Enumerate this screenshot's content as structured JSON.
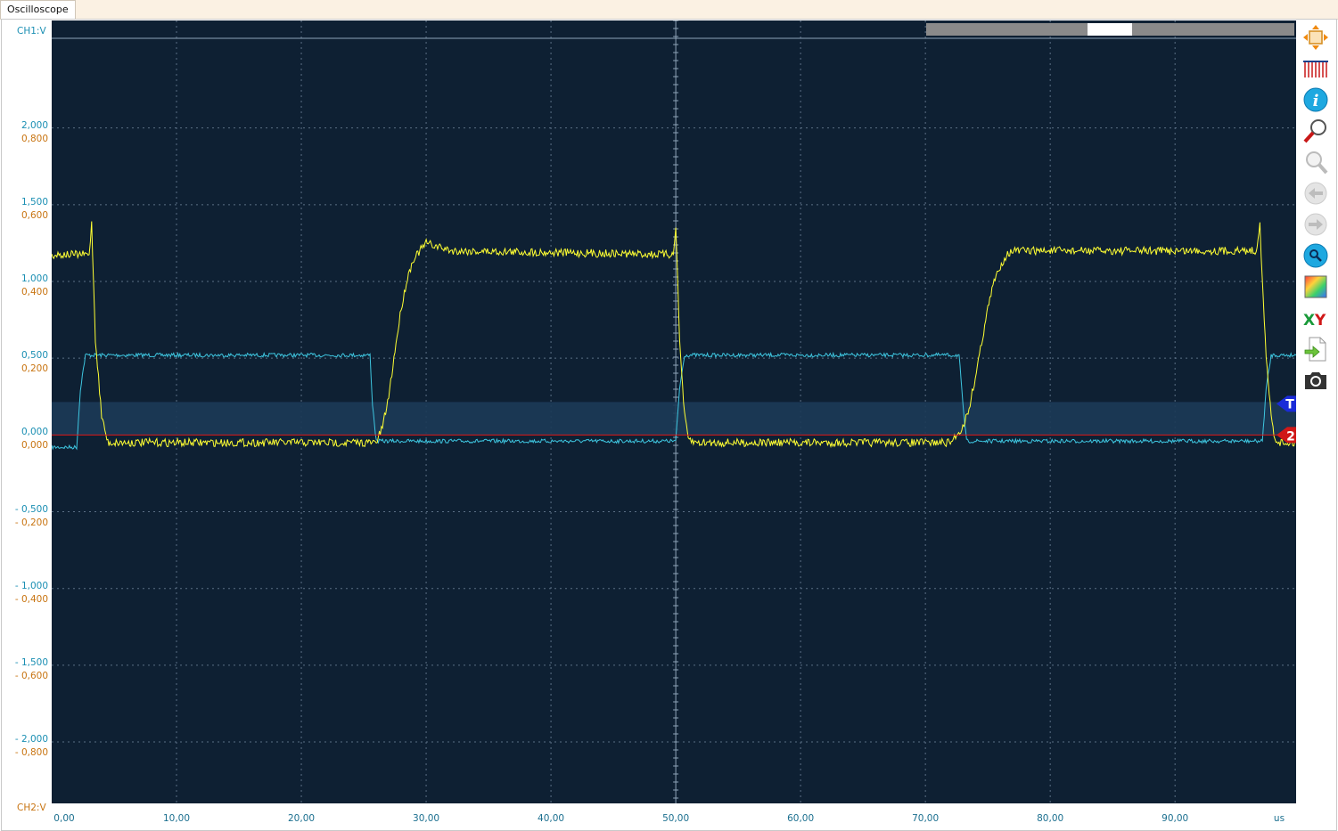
{
  "window": {
    "tab_label": "Oscilloscope"
  },
  "axes": {
    "ch1_title": "CH1:V",
    "ch2_title": "CH2:V",
    "x_unit": "us",
    "x_ticks": [
      "0,00",
      "10,00",
      "20,00",
      "30,00",
      "40,00",
      "50,00",
      "60,00",
      "70,00",
      "80,00",
      "90,00"
    ],
    "ch1_ticks": [
      "2,000",
      "1,500",
      "1,000",
      "0,500",
      "0,000",
      "- 0,500",
      "- 1,000",
      "- 1,500",
      "- 2,000"
    ],
    "ch2_ticks": [
      "0,800",
      "0,600",
      "0,400",
      "0,200",
      "0,000",
      "- 0,200",
      "- 0,400",
      "- 0,600",
      "- 0,800"
    ]
  },
  "markers": {
    "trigger": "T",
    "channel2": "2"
  },
  "toolbar": {
    "items": [
      {
        "icon": "fit-screen-icon"
      },
      {
        "icon": "sampling-bars-icon"
      },
      {
        "icon": "info-icon"
      },
      {
        "icon": "zoom-in-icon"
      },
      {
        "icon": "zoom-out-icon"
      },
      {
        "icon": "back-arrow-icon"
      },
      {
        "icon": "forward-arrow-icon"
      },
      {
        "icon": "zoom-reset-icon"
      },
      {
        "icon": "color-palette-icon"
      },
      {
        "icon": "xy-mode-icon"
      },
      {
        "icon": "export-icon"
      },
      {
        "icon": "camera-icon"
      }
    ]
  },
  "colors": {
    "plot_bg": "#0e2033",
    "ch1": "#3ec6e0",
    "ch2": "#ffff33",
    "trigger_line": "#e01818",
    "ch1_label": "#1b8fb3",
    "ch2_label": "#c87411"
  },
  "chart_data": {
    "type": "line",
    "xlabel": "us",
    "xlim": [
      0,
      99.7
    ],
    "series": [
      {
        "name": "CH1",
        "axis": "left",
        "ylim": [
          -2.4,
          2.7
        ],
        "x": [
          0,
          2.0,
          2.3,
          2.7,
          25.5,
          25.7,
          26.0,
          50.0,
          50.3,
          50.7,
          72.7,
          73.0,
          73.3,
          97.0,
          97.3,
          97.7,
          99.7
        ],
        "y": [
          -0.08,
          -0.08,
          0.3,
          0.52,
          0.52,
          0.2,
          -0.04,
          -0.04,
          0.3,
          0.52,
          0.52,
          0.2,
          -0.04,
          -0.04,
          0.3,
          0.52,
          0.52
        ]
      },
      {
        "name": "CH2",
        "axis": "right",
        "ylim": [
          -0.96,
          1.08
        ],
        "x": [
          0,
          3.0,
          3.2,
          3.5,
          4.0,
          4.5,
          5.0,
          26.0,
          26.5,
          27.0,
          27.5,
          28.0,
          28.5,
          29.0,
          29.5,
          30.0,
          31.0,
          32.0,
          49.8,
          50.0,
          50.3,
          50.7,
          51.0,
          51.5,
          52.0,
          72.0,
          73.0,
          73.5,
          74.0,
          74.5,
          75.0,
          75.5,
          76.0,
          76.5,
          77.0,
          78.0,
          79.0,
          96.5,
          96.8,
          97.0,
          97.3,
          97.7,
          98.0,
          98.5,
          99.7
        ],
        "y": [
          0.47,
          0.47,
          0.55,
          0.25,
          0.05,
          -0.02,
          -0.02,
          -0.02,
          0.02,
          0.1,
          0.22,
          0.33,
          0.41,
          0.46,
          0.48,
          0.5,
          0.49,
          0.48,
          0.47,
          0.55,
          0.25,
          0.05,
          -0.01,
          -0.02,
          -0.02,
          -0.02,
          0.02,
          0.07,
          0.15,
          0.24,
          0.33,
          0.4,
          0.44,
          0.47,
          0.48,
          0.48,
          0.48,
          0.48,
          0.55,
          0.4,
          0.2,
          0.05,
          -0.01,
          -0.02,
          -0.02
        ]
      }
    ],
    "trigger_level_ch2": 0.0,
    "grid": true
  }
}
